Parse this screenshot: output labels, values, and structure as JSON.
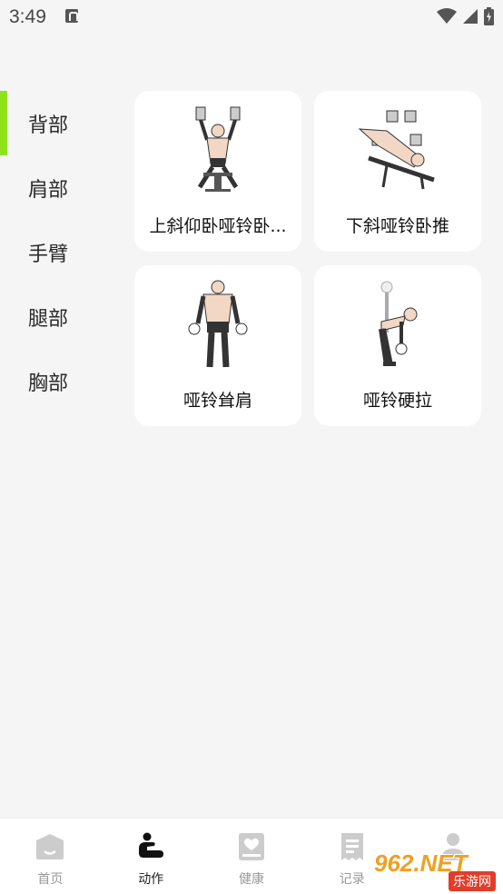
{
  "status_bar": {
    "time": "3:49"
  },
  "sidebar": {
    "items": [
      {
        "label": "背部",
        "active": true
      },
      {
        "label": "肩部",
        "active": false
      },
      {
        "label": "手臂",
        "active": false
      },
      {
        "label": "腿部",
        "active": false
      },
      {
        "label": "胸部",
        "active": false
      }
    ]
  },
  "exercises": [
    {
      "label": "上斜仰卧哑铃卧...",
      "icon": "incline-dumbbell-press-illustration"
    },
    {
      "label": "下斜哑铃卧推",
      "icon": "decline-dumbbell-press-illustration"
    },
    {
      "label": "哑铃耸肩",
      "icon": "dumbbell-shrug-illustration"
    },
    {
      "label": "哑铃硬拉",
      "icon": "dumbbell-deadlift-illustration"
    }
  ],
  "bottom_nav": {
    "items": [
      {
        "label": "首页",
        "icon": "home-icon",
        "active": false
      },
      {
        "label": "动作",
        "icon": "exercise-icon",
        "active": true
      },
      {
        "label": "健康",
        "icon": "health-icon",
        "active": false
      },
      {
        "label": "记录",
        "icon": "record-icon",
        "active": false
      },
      {
        "label": "",
        "icon": "profile-icon",
        "active": false
      }
    ]
  },
  "watermark": {
    "main": "962.NET",
    "sub": "乐游网"
  },
  "colors": {
    "accent": "#8fe31a",
    "background": "#f5f5f5",
    "card": "#ffffff"
  }
}
